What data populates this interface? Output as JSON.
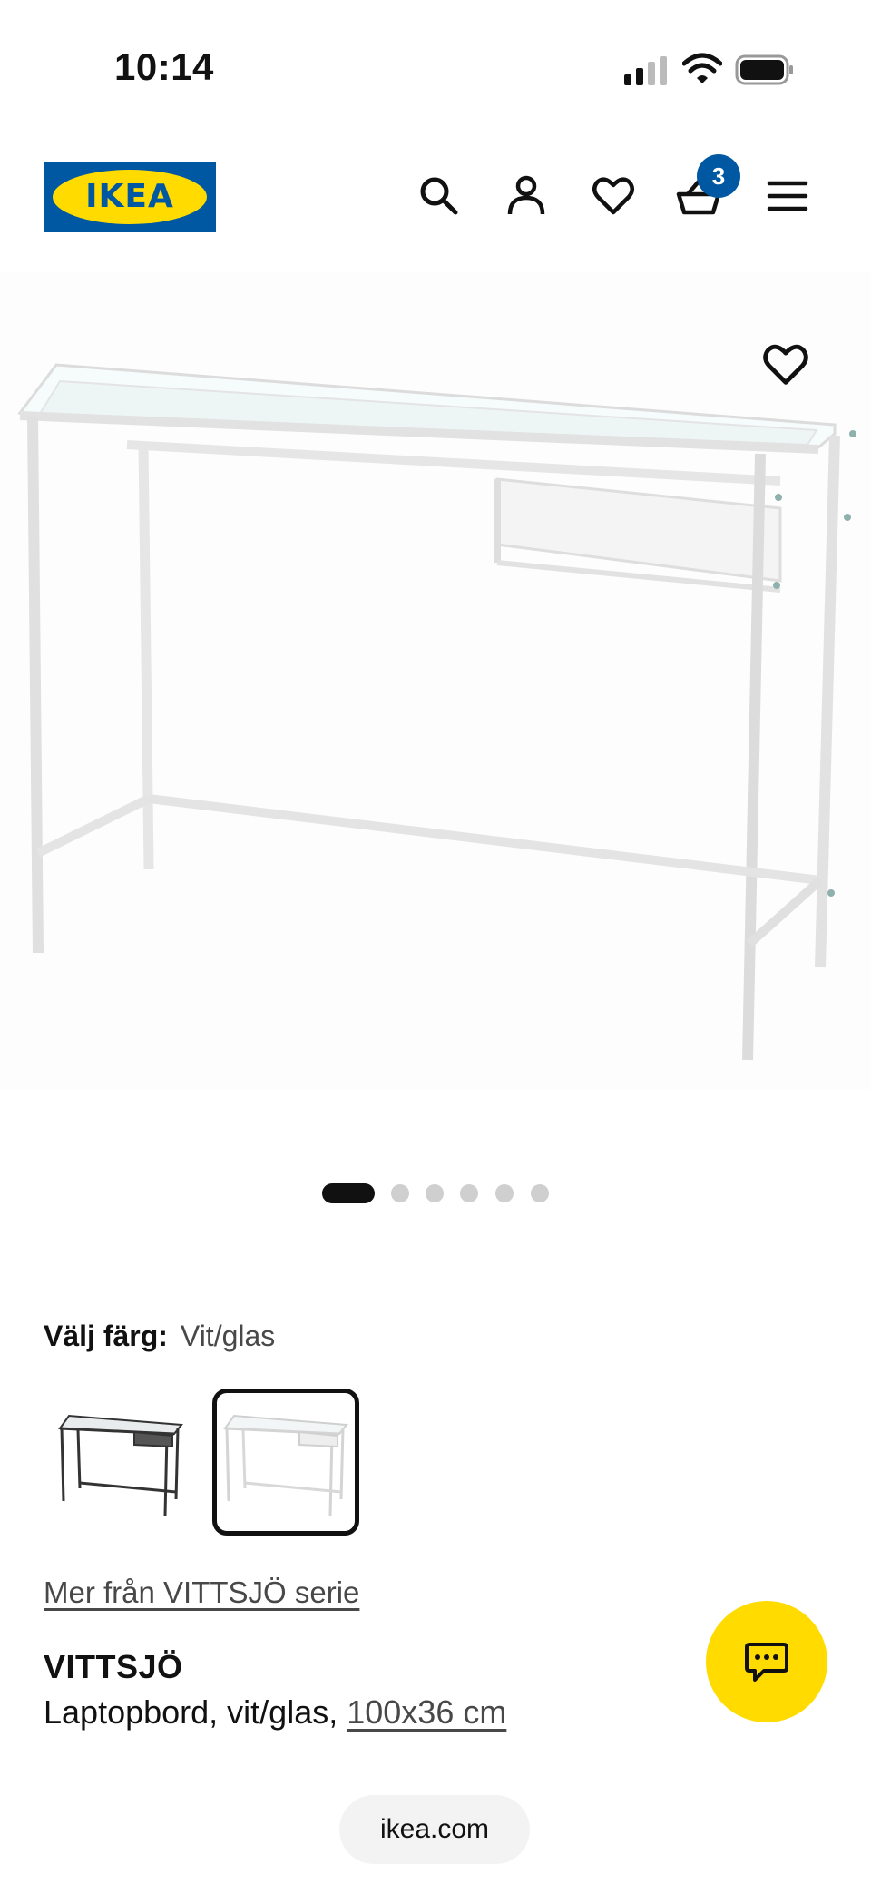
{
  "status_bar": {
    "time": "10:14",
    "icons": [
      "cellular-signal-icon",
      "wifi-icon",
      "battery-icon"
    ]
  },
  "header": {
    "logo_text": "IKEA",
    "icons": [
      "search-icon",
      "account-icon",
      "favorites-icon",
      "cart-icon",
      "menu-icon"
    ],
    "cart_count": "3"
  },
  "product_image": {
    "favorite_icon": "heart-icon",
    "carousel": {
      "total": 6,
      "active_index": 0
    }
  },
  "color_select": {
    "label": "Välj färg:",
    "value": "Vit/glas",
    "options": [
      {
        "name": "black-variant",
        "selected": false
      },
      {
        "name": "white-variant",
        "selected": true
      }
    ]
  },
  "series_link": "Mer från VITTSJÖ serie",
  "product": {
    "name": "VITTSJÖ",
    "description": "Laptopbord, vit/glas,",
    "dimensions": "100x36 cm"
  },
  "chat": {
    "icon": "chat-icon"
  },
  "url_bar": {
    "url": "ikea.com"
  },
  "colors": {
    "ikea_blue": "#0058a3",
    "ikea_yellow": "#ffdb00"
  }
}
